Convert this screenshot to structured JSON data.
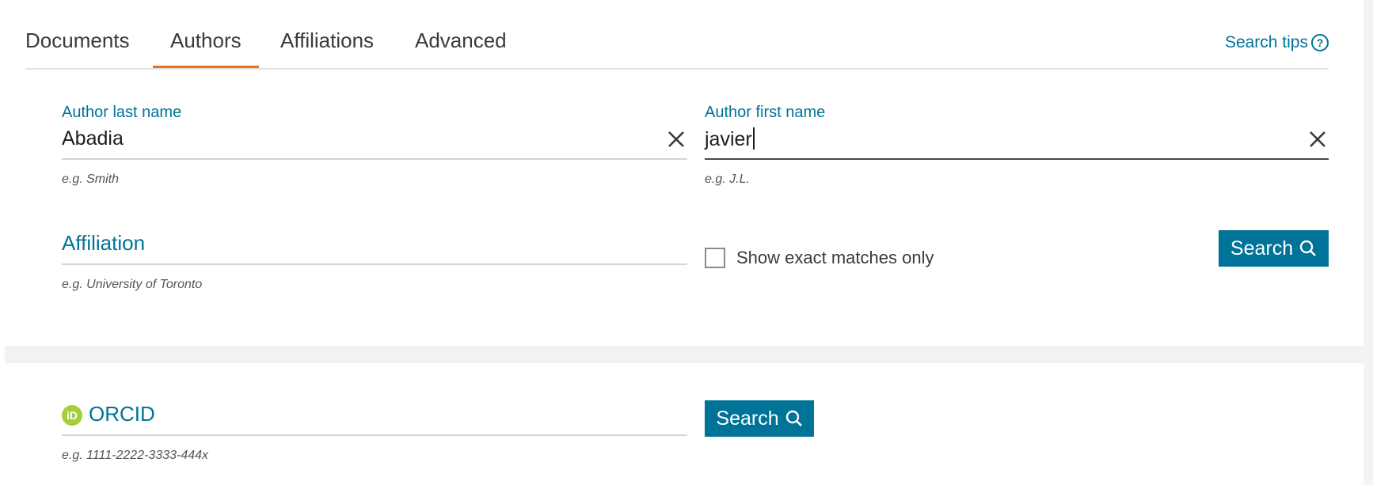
{
  "tabs": [
    {
      "label": "Documents",
      "active": false
    },
    {
      "label": "Authors",
      "active": true
    },
    {
      "label": "Affiliations",
      "active": false
    },
    {
      "label": "Advanced",
      "active": false
    }
  ],
  "search_tips": {
    "label": "Search tips",
    "icon": "help-circle-icon"
  },
  "author_search": {
    "last_name": {
      "label": "Author last name",
      "value": "Abadia",
      "hint": "e.g. Smith",
      "clear_icon": "close-icon"
    },
    "first_name": {
      "label": "Author first name",
      "value": "javier",
      "hint": "e.g. J.L.",
      "clear_icon": "close-icon"
    },
    "affiliation": {
      "label": "Affiliation",
      "value": "",
      "hint": "e.g. University of Toronto"
    },
    "exact_match": {
      "label": "Show exact matches only",
      "checked": false
    },
    "search_button": {
      "label": "Search",
      "icon": "search-icon"
    }
  },
  "orcid_search": {
    "label": "ORCID",
    "badge_text": "iD",
    "value": "",
    "hint": "e.g. 1111-2222-3333-444x",
    "search_button": {
      "label": "Search",
      "icon": "search-icon"
    }
  },
  "colors": {
    "accent": "#007398",
    "active_tab": "#e9711c",
    "orcid": "#a6ce39",
    "band": "#f2f2f2"
  }
}
